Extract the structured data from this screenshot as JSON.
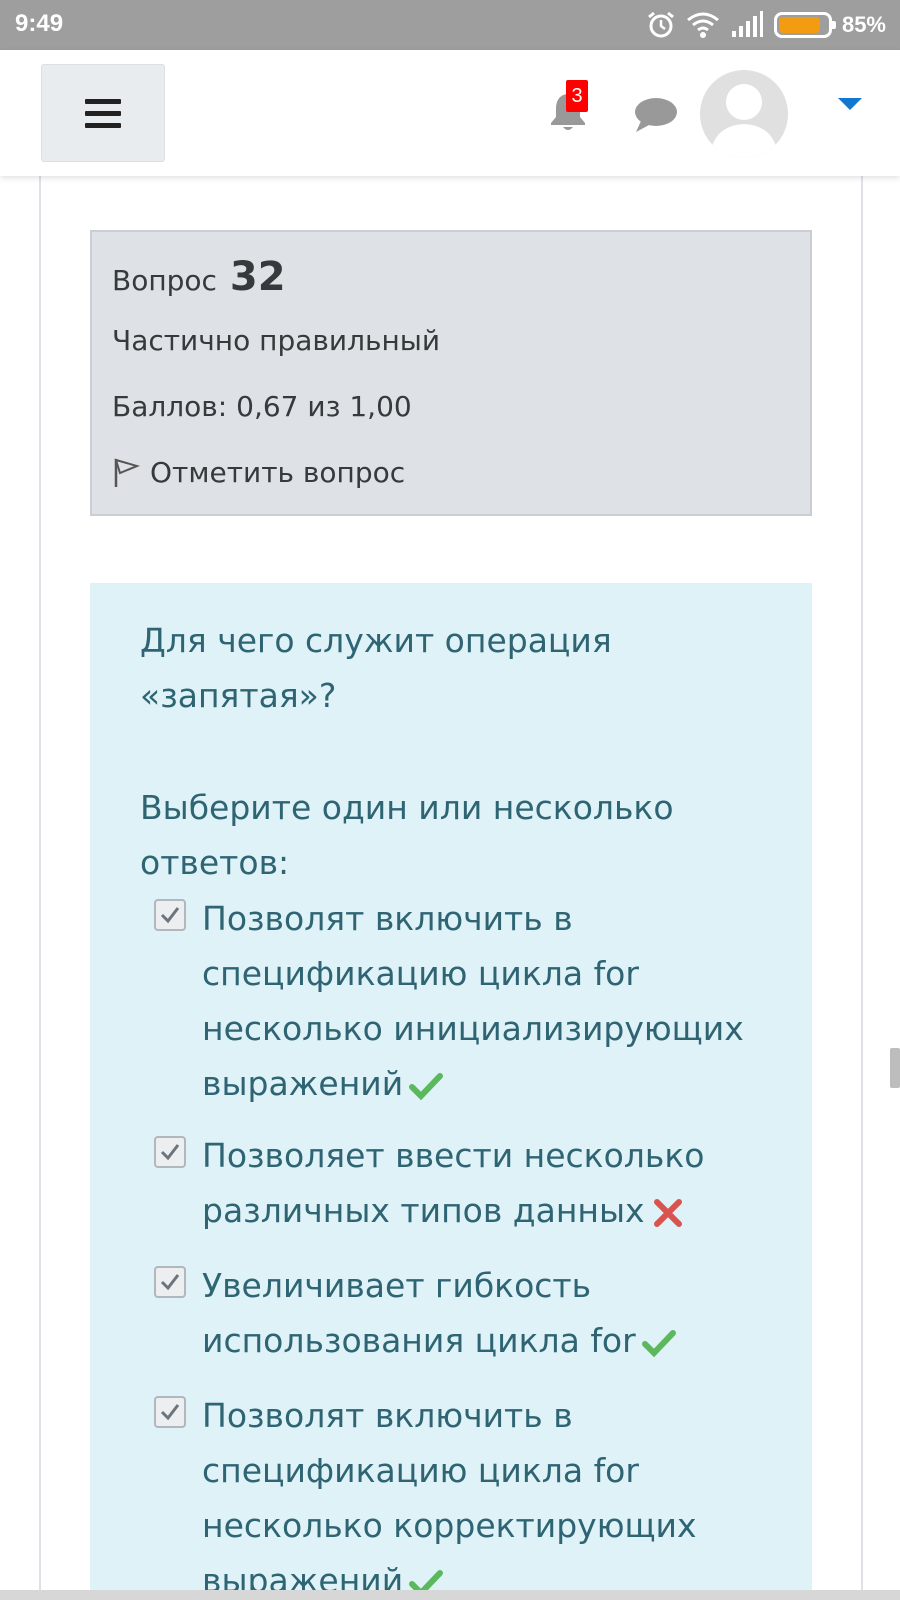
{
  "status_bar": {
    "time": "9:49",
    "battery_percent_text": "85%",
    "battery_level": 0.85,
    "icons": [
      "alarm-icon",
      "wifi-icon",
      "signal-icon",
      "battery-icon"
    ]
  },
  "navbar": {
    "menu_icon": "hamburger-icon",
    "notification_count": "3",
    "icons": [
      "bell-icon",
      "chat-icon",
      "avatar",
      "caret-down-icon"
    ],
    "accent_color": "#1177d1"
  },
  "question_info": {
    "label": "Вопрос",
    "number": "32",
    "state": "Частично правильный",
    "grade": "Баллов: 0,67 из 1,00",
    "flag_label": "Отметить вопрос"
  },
  "question": {
    "text": "Для чего служит операция «запятая»?",
    "prompt": "Выберите один или несколько ответов:",
    "answers": [
      {
        "label": "Позволят включить в спецификацию цикла for несколько инициализирующих выражений",
        "checked": true,
        "result": "correct"
      },
      {
        "label": "Позволяет ввести несколько различных типов данных",
        "checked": true,
        "result": "incorrect"
      },
      {
        "label": "Увеличивает гибкость использования цикла for",
        "checked": true,
        "result": "correct"
      },
      {
        "label": "Позволят включить в спецификацию цикла for несколько корректирующих выражений",
        "checked": true,
        "result": "correct"
      }
    ]
  },
  "colors": {
    "info_bg": "#dee2e6",
    "formulation_bg": "#def2f8",
    "formulation_text": "#2f6473",
    "correct": "#5cb85c",
    "incorrect": "#d9534f",
    "badge": "#ff0000"
  }
}
